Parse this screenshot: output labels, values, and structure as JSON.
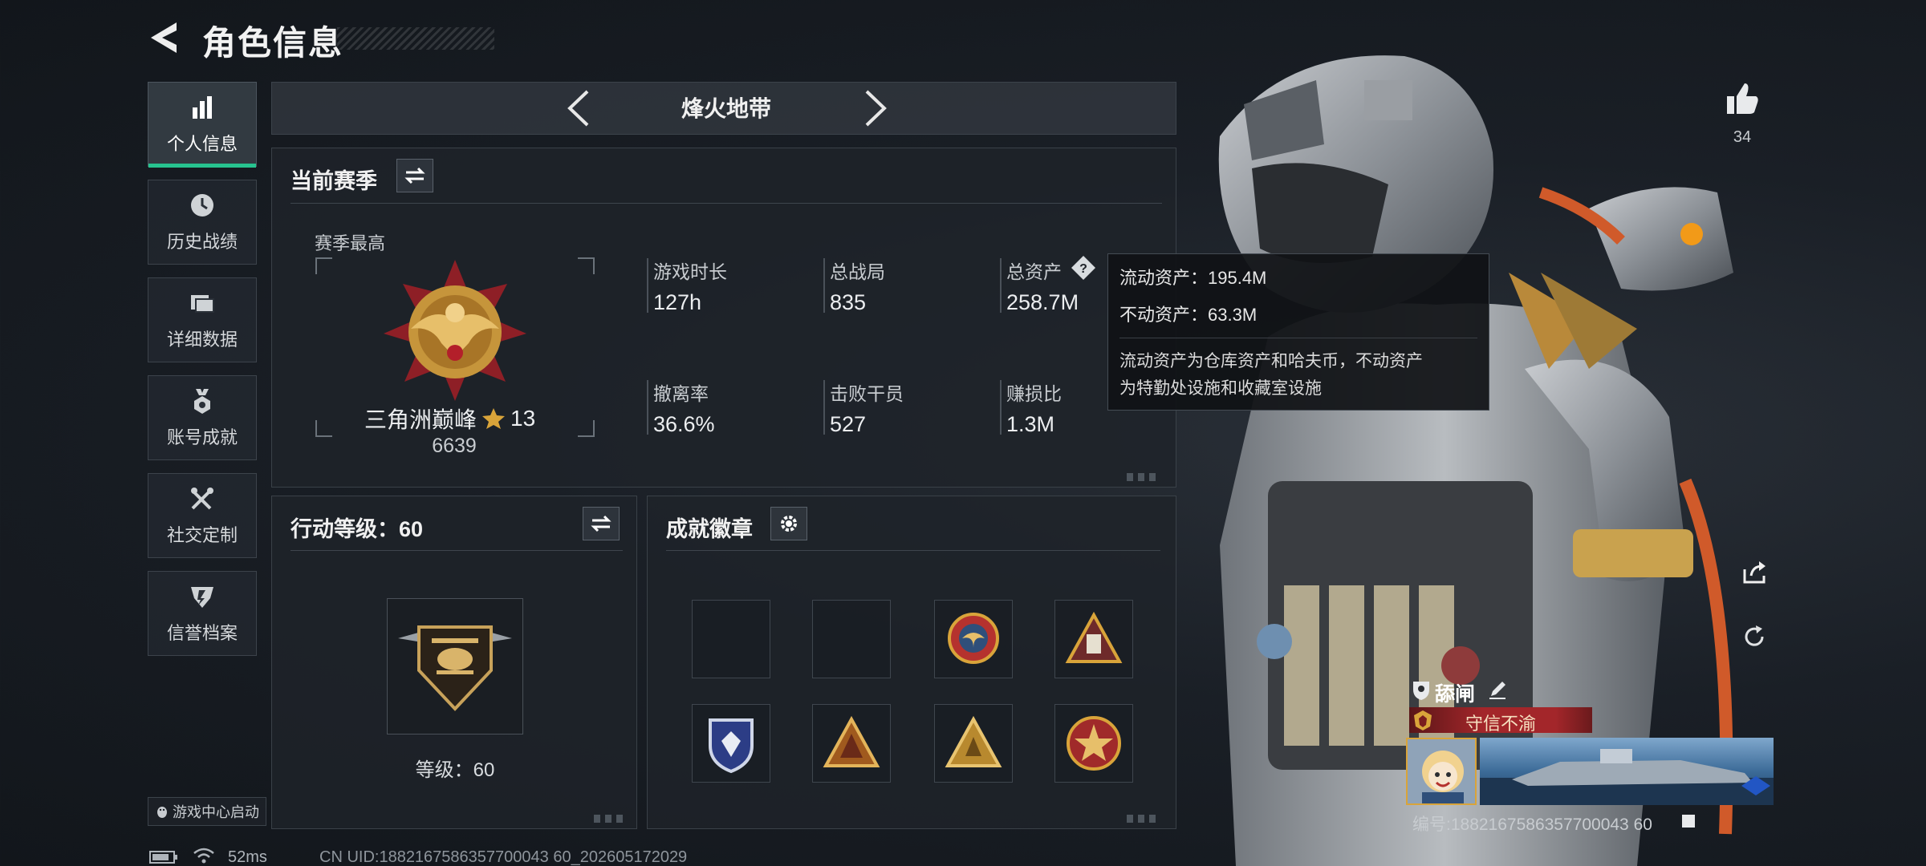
{
  "header": {
    "title": "角色信息"
  },
  "nav": {
    "items": [
      {
        "label": "个人信息",
        "icon": "bar-chart-icon",
        "active": true
      },
      {
        "label": "历史战绩",
        "icon": "clock-icon",
        "active": false
      },
      {
        "label": "详细数据",
        "icon": "folder-icon",
        "active": false
      },
      {
        "label": "账号成就",
        "icon": "medal-icon",
        "active": false
      },
      {
        "label": "社交定制",
        "icon": "tools-icon",
        "active": false
      },
      {
        "label": "信誉档案",
        "icon": "shield-icon",
        "active": false
      }
    ],
    "game_center_label": "游戏中心启动"
  },
  "mode": {
    "title": "烽火地带"
  },
  "season": {
    "title": "当前赛季",
    "best_label": "赛季最高",
    "rank_name": "三角洲巅峰",
    "rank_stars": "13",
    "rank_score": "6639",
    "stats": [
      {
        "label": "游戏时长",
        "value": "127h"
      },
      {
        "label": "总战局",
        "value": "835"
      },
      {
        "label": "总资产",
        "value": "258.7M"
      },
      {
        "label": "撤离率",
        "value": "36.6%"
      },
      {
        "label": "击败干员",
        "value": "527"
      },
      {
        "label": "赚损比",
        "value": "1.3M"
      }
    ]
  },
  "tooltip": {
    "liquid": "流动资产：195.4M",
    "fixed": "不动资产：63.3M",
    "desc_line1": "流动资产为仓库资产和哈夫币，不动资产",
    "desc_line2": "为特勤处设施和收藏室设施"
  },
  "level": {
    "title": "行动等级：60",
    "caption": "等级：60"
  },
  "badges": {
    "title": "成就徽章",
    "slots": [
      "empty",
      "empty",
      "eagle-badge",
      "triangle-badge",
      "shield-badge",
      "triangle-badge",
      "triangle-badge",
      "star-badge"
    ]
  },
  "profile": {
    "likes": "34",
    "name": "舔闸",
    "player_title": "守信不渝",
    "id_text": "编号:1882167586357700043 60"
  },
  "status": {
    "ping": "52ms",
    "uid": "CN UID:1882167586357700043 60_202605172029"
  },
  "colors": {
    "accent": "#27c38f",
    "title_red": "#a3262a",
    "gold": "#d9a43a"
  }
}
